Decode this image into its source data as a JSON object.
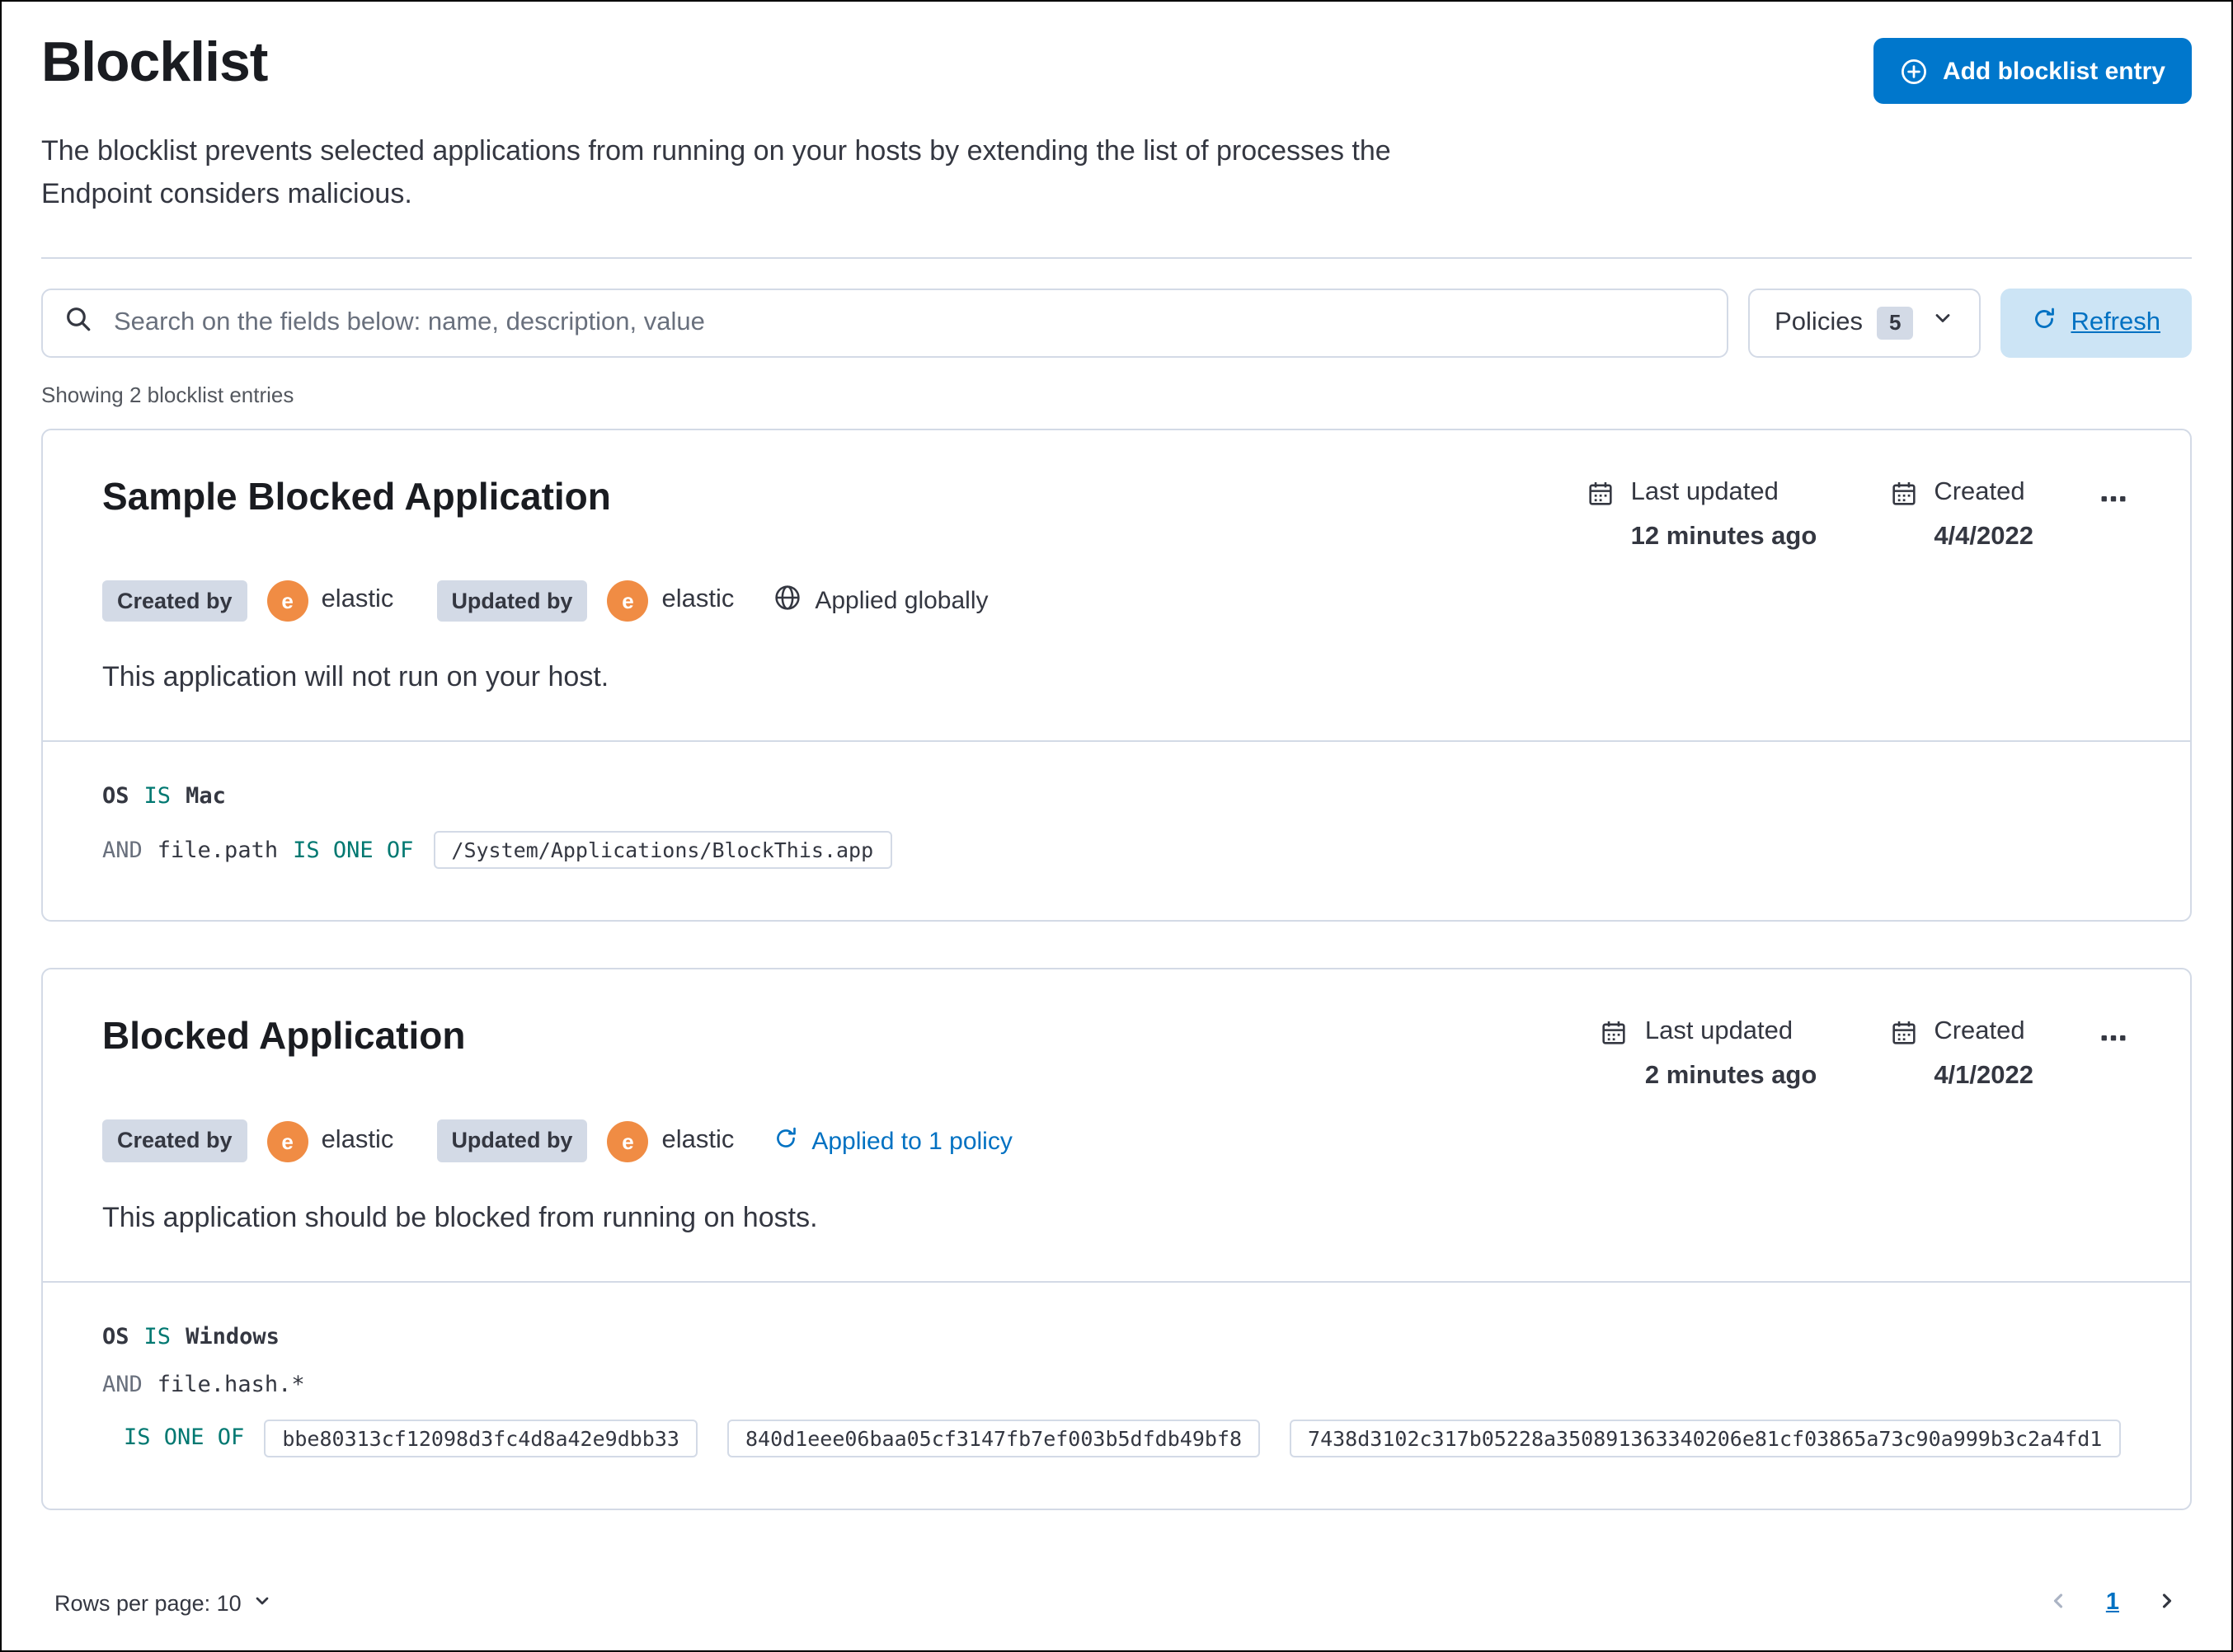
{
  "page": {
    "title": "Blocklist",
    "description": "The blocklist prevents selected applications from running on your hosts by extending the list of processes the Endpoint considers malicious.",
    "add_button_label": "Add blocklist entry",
    "showing_text": "Showing 2 blocklist entries"
  },
  "toolbar": {
    "search_placeholder": "Search on the fields below: name, description, value",
    "policies_label": "Policies",
    "policies_count": "5",
    "refresh_label": "Refresh"
  },
  "entries": [
    {
      "title": "Sample Blocked Application",
      "created_by_label": "Created by",
      "created_by_user": "elastic",
      "updated_by_label": "Updated by",
      "updated_by_user": "elastic",
      "avatar_initial": "e",
      "scope_label": "Applied globally",
      "last_updated_label": "Last updated",
      "last_updated_value": "12 minutes ago",
      "created_label": "Created",
      "created_value": "4/4/2022",
      "description": "This application will not run on your host.",
      "criteria": {
        "os_field": "OS",
        "os_operator": "IS",
        "os_value": "Mac",
        "and_label": "AND",
        "field": "file.path",
        "operator": "IS ONE OF",
        "values": [
          "/System/Applications/BlockThis.app"
        ]
      }
    },
    {
      "title": "Blocked Application",
      "created_by_label": "Created by",
      "created_by_user": "elastic",
      "updated_by_label": "Updated by",
      "updated_by_user": "elastic",
      "avatar_initial": "e",
      "scope_label": "Applied to 1 policy",
      "last_updated_label": "Last updated",
      "last_updated_value": "2 minutes ago",
      "created_label": "Created",
      "created_value": "4/1/2022",
      "description": "This application should be blocked from running on hosts.",
      "criteria": {
        "os_field": "OS",
        "os_operator": "IS",
        "os_value": "Windows",
        "and_label": "AND",
        "field": "file.hash.*",
        "operator": "IS ONE OF",
        "values": [
          "bbe80313cf12098d3fc4d8a42e9dbb33",
          "840d1eee06baa05cf3147fb7ef003b5dfdb49bf8",
          "7438d3102c317b05228a350891363340206e81cf03865a73c90a999b3c2a4fd1"
        ]
      }
    }
  ],
  "footer": {
    "rows_per_page_label": "Rows per page: 10",
    "page_number": "1"
  },
  "colors": {
    "primary_button": "#0077CC",
    "refresh_button_bg": "#CCE4F5",
    "link_blue": "#0071C2",
    "operator_teal": "#007871",
    "badge_bg": "#D3DAE6",
    "avatar_orange": "#F08C44",
    "border_gray": "#D3DAE6",
    "text_dark": "#343741"
  }
}
